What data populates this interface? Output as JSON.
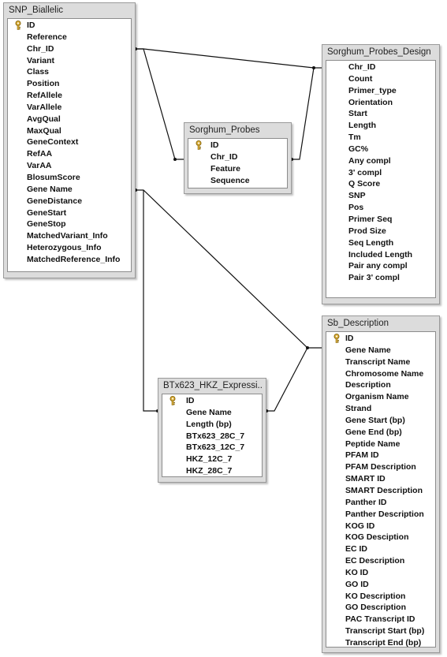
{
  "tables": {
    "snp_biallelic": {
      "title": "SNP_Biallelic",
      "fields": [
        "ID",
        "Reference",
        "Chr_ID",
        "Variant",
        "Class",
        "Position",
        "RefAllele",
        "VarAllele",
        "AvgQual",
        "MaxQual",
        "GeneContext",
        "RefAA",
        "VarAA",
        "BlosumScore",
        "Gene Name",
        "GeneDistance",
        "GeneStart",
        "GeneStop",
        "MatchedVariant_Info",
        "Heterozygous_Info",
        "MatchedReference_Info"
      ]
    },
    "sorghum_probes_design": {
      "title": "Sorghum_Probes_Design",
      "fields": [
        "Chr_ID",
        "Count",
        "Primer_type",
        "Orientation",
        "Start",
        "Length",
        "Tm",
        "GC%",
        "Any compl",
        "3' compl",
        "Q Score",
        "SNP",
        "Pos",
        "Primer Seq",
        "Prod Size",
        "Seq Length",
        "Included Length",
        "Pair any compl",
        "Pair 3' compl"
      ]
    },
    "sorghum_probes": {
      "title": "Sorghum_Probes",
      "fields": [
        "ID",
        "Chr_ID",
        "Feature",
        "Sequence"
      ]
    },
    "btx623_hkz": {
      "title": "BTx623_HKZ_Expressi...",
      "fields": [
        "ID",
        "Gene Name",
        "Length (bp)",
        "BTx623_28C_7",
        "BTx623_12C_7",
        "HKZ_12C_7",
        "HKZ_28C_7"
      ]
    },
    "sb_description": {
      "title": "Sb_Description",
      "fields": [
        "ID",
        "Gene Name",
        "Transcript Name",
        "Chromosome Name",
        "Description",
        "Organism Name",
        "Strand",
        "Gene Start (bp)",
        "Gene End (bp)",
        "Peptide Name",
        "PFAM ID",
        "PFAM Description",
        "SMART ID",
        "SMART Description",
        "Panther ID",
        "Panther Description",
        "KOG ID",
        "KOG Desciption",
        "EC ID",
        "EC Description",
        "KO ID",
        "GO ID",
        "KO Description",
        "GO Description",
        "PAC Transcript ID",
        "Transcript Start (bp)",
        "Transcript End (bp)"
      ]
    }
  },
  "icons": {
    "primary_key": "key-icon"
  }
}
